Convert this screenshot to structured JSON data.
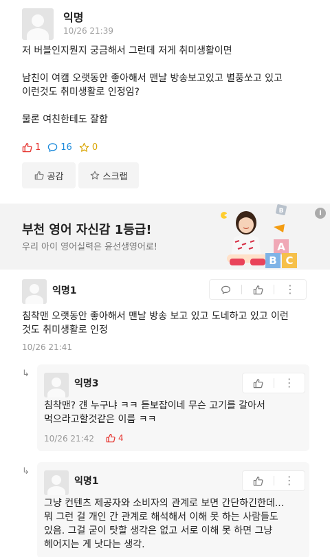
{
  "post": {
    "author": "익명",
    "time": "10/26 21:39",
    "lines": [
      "저 버블인지뭔지 궁금해서 그런데 저게 취미생활이면",
      "남친이 여캠 오랫동안 좋아해서 맨날 방송보고있고 별풍쏘고 있고",
      "이런것도 취미생활로 인정임?",
      "물론 여친한테도 잘함"
    ],
    "like_count": "1",
    "comment_count": "16",
    "scrap_count": "0",
    "like_button": "공감",
    "scrap_button": "스크랩"
  },
  "ad": {
    "title": "부천 영어 자신감 1등급!",
    "subtitle": "우리 아이 영어실력은 윤선생영어로!",
    "info": "i",
    "blocks": [
      "A",
      "B",
      "C",
      "B"
    ]
  },
  "comments": [
    {
      "author": "익명1",
      "lines": [
        "침착맨 오랫동안 좋아해서 맨날 방송 보고 있고 도네하고 있고 이런",
        "것도 취미생활로 인정"
      ],
      "time": "10/26 21:41"
    }
  ],
  "replies": [
    {
      "author": "익명3",
      "lines": [
        "침착맨? 걘 누구냐 ㅋㅋ 듣보잡이네 무슨 고기를 갈아서",
        "먹으라고할것같은 이름 ㅋㅋ"
      ],
      "time": "10/26 21:42",
      "likes": "4"
    },
    {
      "author": "익명1",
      "lines": [
        "그냥 컨텐츠 제공자와 소비자의 관계로 보면 간단하긴한데...",
        "뭐 그런 걸 개인 간 관계로 해석해서 이해 못 하는 사람들도",
        "있음. 그걸 굳이 탓할 생각은 없고 서로 이해 못 하면 그냥",
        "헤어지는 게 낫다는 생각."
      ]
    }
  ],
  "colors": {
    "like": "#e5322d",
    "comment": "#1c8adb",
    "scrap": "#d9a400"
  },
  "icons": {
    "kebab": "⋮",
    "reply_arrow": "↳"
  }
}
